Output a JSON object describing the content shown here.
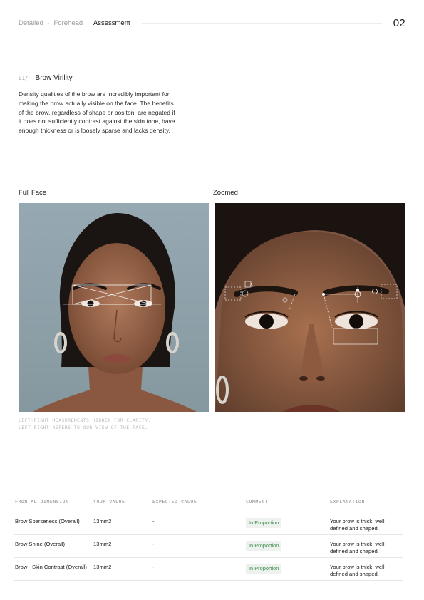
{
  "header": {
    "breadcrumbs": [
      "Detailed",
      "Forehead",
      "Assessment"
    ],
    "page_number": "02"
  },
  "section": {
    "number": "01/",
    "title": "Brow Virility",
    "body": "Density qualities of the brow are incredibly important for making the brow actually visible on the face. The benefits of the brow, regardless of shape or positon, are negated if it does not sufficiently contrast against the skin tone, have enough thickness or is loosely sparse and lacks density."
  },
  "images": {
    "full_label": "Full Face",
    "zoom_label": "Zoomed",
    "zoom_marker": "A",
    "caption_line1": "LEFT-RIGHT MEASUREMENTS HIDDEN FOR CLARITY.",
    "caption_line2": "LEFT-RIGHT REFERS TO OUR VIEW OF THE FACE."
  },
  "table": {
    "headers": [
      "FRONTAL DIMENSION",
      "YOUR VALUE",
      "EXPECTED VALUE",
      "COMMENT",
      "EXPLANATION"
    ],
    "rows": [
      {
        "dimension": "Brow Sparseness (Overall)",
        "value": "13mm2",
        "expected": "-",
        "comment": "In Proportion",
        "explanation": "Your brow is thick, well defined and shaped."
      },
      {
        "dimension": "Brow Shine (Overall)",
        "value": "13mm2",
        "expected": "-",
        "comment": "In Proportion",
        "explanation": "Your brow is thick, well defined and shaped."
      },
      {
        "dimension": "Brow - Skin Contrast (Overall)",
        "value": "13mm2",
        "expected": "-",
        "comment": "In Proportion",
        "explanation": "Your brow is thick, well defined and shaped."
      }
    ]
  },
  "colors": {
    "comment_text": "#3d8a4a",
    "comment_bg": "#eef2ee",
    "full_photo_bg": "#8fa1ab"
  }
}
